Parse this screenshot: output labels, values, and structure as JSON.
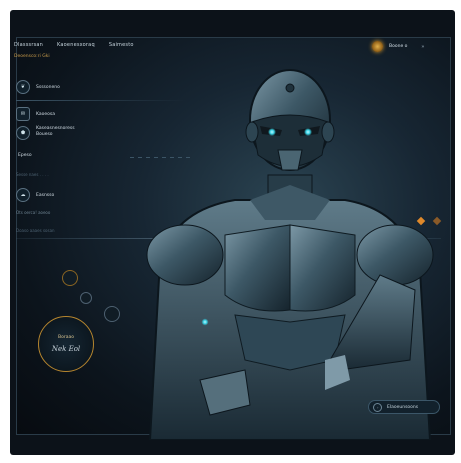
{
  "nav": {
    "items": [
      "Dlasssrsan",
      "Kaoenesxoraq",
      "Saimesto"
    ],
    "subtitle": "Deoensco:ri  Gki"
  },
  "account": {
    "name": "Boone  o",
    "chevron": "»"
  },
  "menu": {
    "items": [
      {
        "label": "Ssssoneno",
        "icon": "leaf-icon"
      },
      {
        "label": "Kaoeosa",
        "icon": "chat-icon"
      },
      {
        "label": "Kaseasnesnoress Boueso",
        "icon": "shield-icon"
      }
    ],
    "section_label": "Epeso",
    "faint_label_1": "Sesse naes . . . .",
    "item_4_label": "Easnsso",
    "item_4_icon": "cloud-icon",
    "faint_label_2": "Ots oerca! aoeoo",
    "faint_label_3": "Doaso aaaes sosan"
  },
  "badge": {
    "label": "Boraao",
    "signature": "Nek Eol"
  },
  "action_pill": {
    "label": "Elaoeunsoons"
  },
  "colors": {
    "accent_gold": "#c89b4a",
    "panel_bg": "#0c141c",
    "eye_cyan": "#39d4e6",
    "highlight_orange": "#e0892a"
  }
}
